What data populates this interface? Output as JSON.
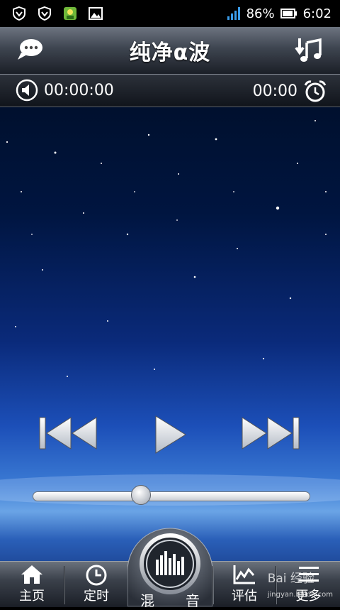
{
  "status_bar": {
    "battery": "86%",
    "time": "6:02"
  },
  "header": {
    "title": "纯净α波"
  },
  "timer_bar": {
    "elapsed": "00:00:00",
    "timer": "00:00"
  },
  "player": {
    "progress_fraction": 0.39
  },
  "bottom_nav": {
    "home_label": "主页",
    "timer_label": "定时",
    "mix_label_left": "混",
    "mix_label_right": "音",
    "evaluate_label": "评估",
    "more_label": "更多"
  },
  "watermark": {
    "text": "Bai 经验",
    "sub": "jingyan.baidu.com"
  },
  "icons": {
    "status": [
      "shield-v-icon",
      "shield-v-icon",
      "app-notification-icon",
      "image-icon",
      "signal-icon",
      "battery-icon"
    ],
    "header": [
      "chat-bubble-icon",
      "music-download-icon"
    ],
    "timer": [
      "volume-icon",
      "alarm-clock-icon"
    ],
    "controls": [
      "previous-icon",
      "play-icon",
      "next-icon"
    ],
    "nav": [
      "home-icon",
      "clock-icon",
      "equalizer-icon",
      "chart-icon",
      "menu-icon"
    ]
  }
}
